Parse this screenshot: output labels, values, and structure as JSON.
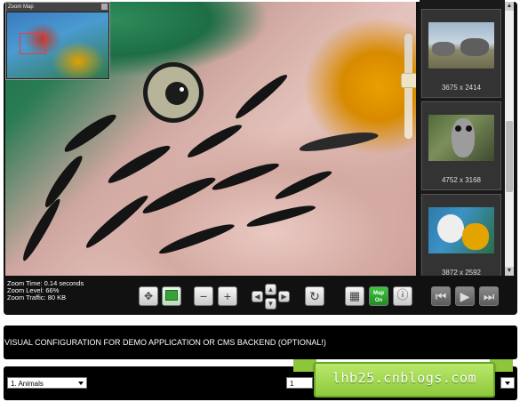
{
  "zoom_map": {
    "title": "Zoom Map"
  },
  "thumbnails": [
    {
      "caption": "3675 x 2414",
      "subject": "rhinos"
    },
    {
      "caption": "4752 x 3168",
      "subject": "owl"
    },
    {
      "caption": "3872 x 2592",
      "subject": "parrot"
    }
  ],
  "status": {
    "zoom_time": "Zoom Time: 0.14 seconds",
    "zoom_level": "Zoom Level: 66%",
    "zoom_traffic": "Zoom Traffic: 80 KB"
  },
  "toolbar": {
    "icons": [
      "pan-icon",
      "region-select-icon",
      "zoom-out-icon",
      "zoom-in-icon",
      "pan-up-icon",
      "pan-left-icon",
      "pan-right-icon",
      "pan-down-icon",
      "reset-icon",
      "grid-icon",
      "map-toggle-icon",
      "info-icon",
      "first-icon",
      "play-icon",
      "last-icon"
    ],
    "map_label_top": "Map",
    "map_label_bottom": "On"
  },
  "banner": {
    "text": "VISUAL CONFIGURATION FOR DEMO APPLICATION OR CMS BACKEND (OPTIONAL!)"
  },
  "bottom_bar": {
    "category_select": "1. Animals",
    "second_select": "1"
  },
  "watermark": {
    "text": "lhb25.cnblogs.com"
  },
  "colors": {
    "background": "#000000",
    "ribbon": "#9ad64a",
    "accent_red": "#ff3333"
  }
}
